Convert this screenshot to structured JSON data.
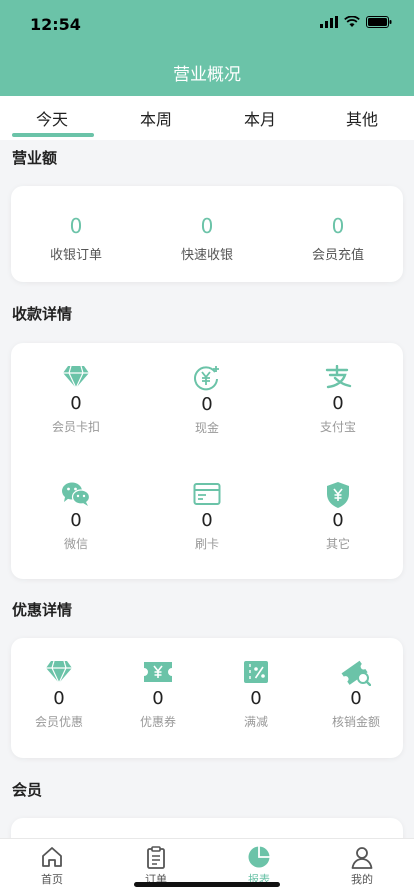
{
  "status_bar": {
    "time": "12:54"
  },
  "header": {
    "title": "营业概况"
  },
  "tabs": [
    {
      "label": "今天",
      "active": true
    },
    {
      "label": "本周"
    },
    {
      "label": "本月"
    },
    {
      "label": "其他"
    }
  ],
  "revenue": {
    "title": "营业额",
    "items": [
      {
        "value": "0",
        "label": "收银订单"
      },
      {
        "value": "0",
        "label": "快速收银"
      },
      {
        "value": "0",
        "label": "会员充值"
      }
    ]
  },
  "payment": {
    "title": "收款详情",
    "items": [
      {
        "value": "0",
        "label": "会员卡扣",
        "icon": "diamond-icon"
      },
      {
        "value": "0",
        "label": "现金",
        "icon": "cash-icon"
      },
      {
        "value": "0",
        "label": "支付宝",
        "icon": "alipay-icon"
      },
      {
        "value": "0",
        "label": "微信",
        "icon": "wechat-icon"
      },
      {
        "value": "0",
        "label": "刷卡",
        "icon": "card-icon"
      },
      {
        "value": "0",
        "label": "其它",
        "icon": "shield-yen-icon"
      }
    ]
  },
  "discount": {
    "title": "优惠详情",
    "items": [
      {
        "value": "0",
        "label": "会员优惠",
        "icon": "diamond-icon"
      },
      {
        "value": "0",
        "label": "优惠券",
        "icon": "coupon-icon"
      },
      {
        "value": "0",
        "label": "满减",
        "icon": "percent-icon"
      },
      {
        "value": "0",
        "label": "核销金额",
        "icon": "ticket-check-icon"
      }
    ]
  },
  "member": {
    "title": "会员"
  },
  "tabbar": [
    {
      "label": "首页",
      "icon": "home-icon"
    },
    {
      "label": "订单",
      "icon": "order-icon"
    },
    {
      "label": "报表",
      "icon": "chart-icon",
      "active": true
    },
    {
      "label": "我的",
      "icon": "user-icon"
    }
  ],
  "colors": {
    "accent": "#6bc3a8",
    "background": "#f4f5f7"
  }
}
